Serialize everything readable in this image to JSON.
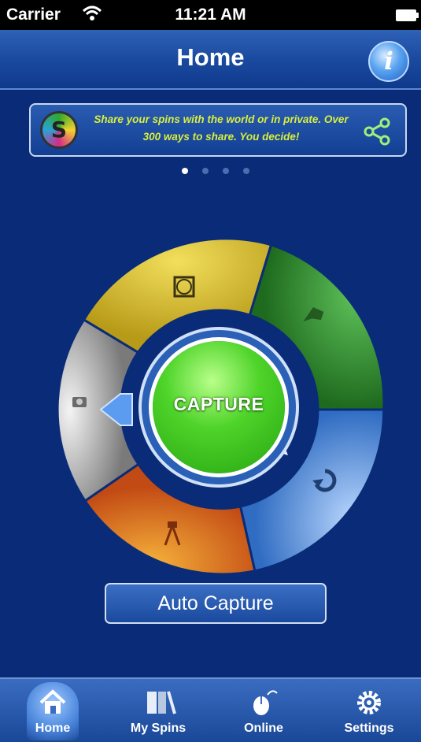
{
  "status_bar": {
    "carrier": "Carrier",
    "time": "11:21 AM"
  },
  "nav": {
    "title": "Home",
    "info_label": "i"
  },
  "banner": {
    "text": "Share your spins with the world or in private. Over 300 ways to share. You decide!"
  },
  "pager": {
    "total": 4,
    "active": 0
  },
  "wheel": {
    "capture_label": "CAPTURE",
    "segments": [
      {
        "name": "frame",
        "color": "#d8c235",
        "icon": "frame-icon"
      },
      {
        "name": "effects",
        "color": "#3e9a3a",
        "icon": "hand-icon"
      },
      {
        "name": "recycle",
        "color": "#4a8ad6",
        "icon": "recycle-icon"
      },
      {
        "name": "tripod",
        "color": "#d86a1c",
        "icon": "tripod-icon"
      },
      {
        "name": "camera",
        "color": "#c8c8c8",
        "icon": "camera-icon"
      }
    ]
  },
  "auto_capture": {
    "label": "Auto Capture"
  },
  "tabs": [
    {
      "label": "Home",
      "icon": "home-icon",
      "active": true
    },
    {
      "label": "My Spins",
      "icon": "film-icon",
      "active": false
    },
    {
      "label": "Online",
      "icon": "mouse-icon",
      "active": false
    },
    {
      "label": "Settings",
      "icon": "gear-icon",
      "active": false
    }
  ],
  "colors": {
    "background": "#0a2c78",
    "nav": "#1a4aa0",
    "banner_text": "#d9ef3a",
    "capture_green": "#4fd42a"
  }
}
